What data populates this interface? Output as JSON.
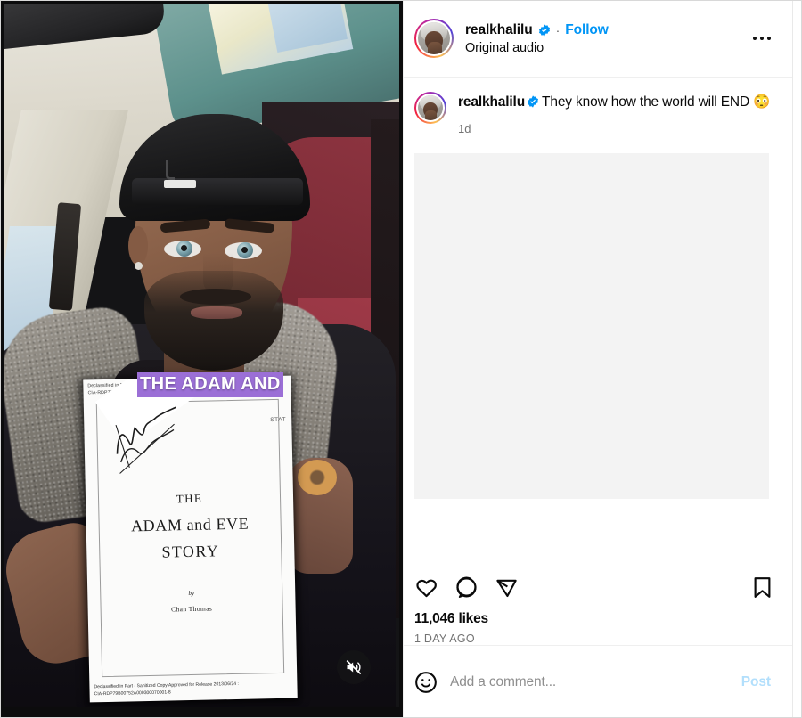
{
  "post": {
    "header": {
      "username": "realkhalilu",
      "verified": true,
      "separator": "·",
      "follow_label": "Follow",
      "audio_label": "Original audio",
      "more_options_label": "More options"
    },
    "caption_comment": {
      "username": "realkhalilu",
      "verified": true,
      "text": "They know how the world will END 😳",
      "time": "1d"
    },
    "actions": {
      "like_label": "Like",
      "comment_label": "Comment",
      "share_label": "Share",
      "save_label": "Save",
      "likes_count": "11,046 likes",
      "time_ago": "1 DAY AGO"
    },
    "add_comment": {
      "placeholder": "Add a comment...",
      "value": "",
      "post_label": "Post",
      "emoji_label": "Emoji picker"
    }
  },
  "video": {
    "caption_overlay": "THE ADAM AND",
    "muted": true,
    "mute_label": "Unmute",
    "document": {
      "header_line1": "Declassified in Part - Sanitized Copy Approved for Release 2013/06/24 :",
      "header_line2": "CIA-RDP79B00752A000300070001-8",
      "stat_mark": "STAT",
      "title_line1": "THE",
      "title_line2": "ADAM and EVE",
      "title_line3": "STORY",
      "byline": "by",
      "author": "Chan Thomas",
      "footer_line1": "Declassified in Part - Sanitized Copy Approved for Release 2013/06/24 :",
      "footer_line2": "CIA-RDP79B00752A000300070001-8"
    }
  },
  "colors": {
    "instagram_blue": "#0095f6",
    "post_disabled_blue": "#b2dffc",
    "secondary_text": "#737373",
    "primary_text": "#0a0a0a",
    "divider": "#efefef",
    "placeholder_bg": "#f3f3f3",
    "caption_highlight": "#9b6fd6"
  }
}
